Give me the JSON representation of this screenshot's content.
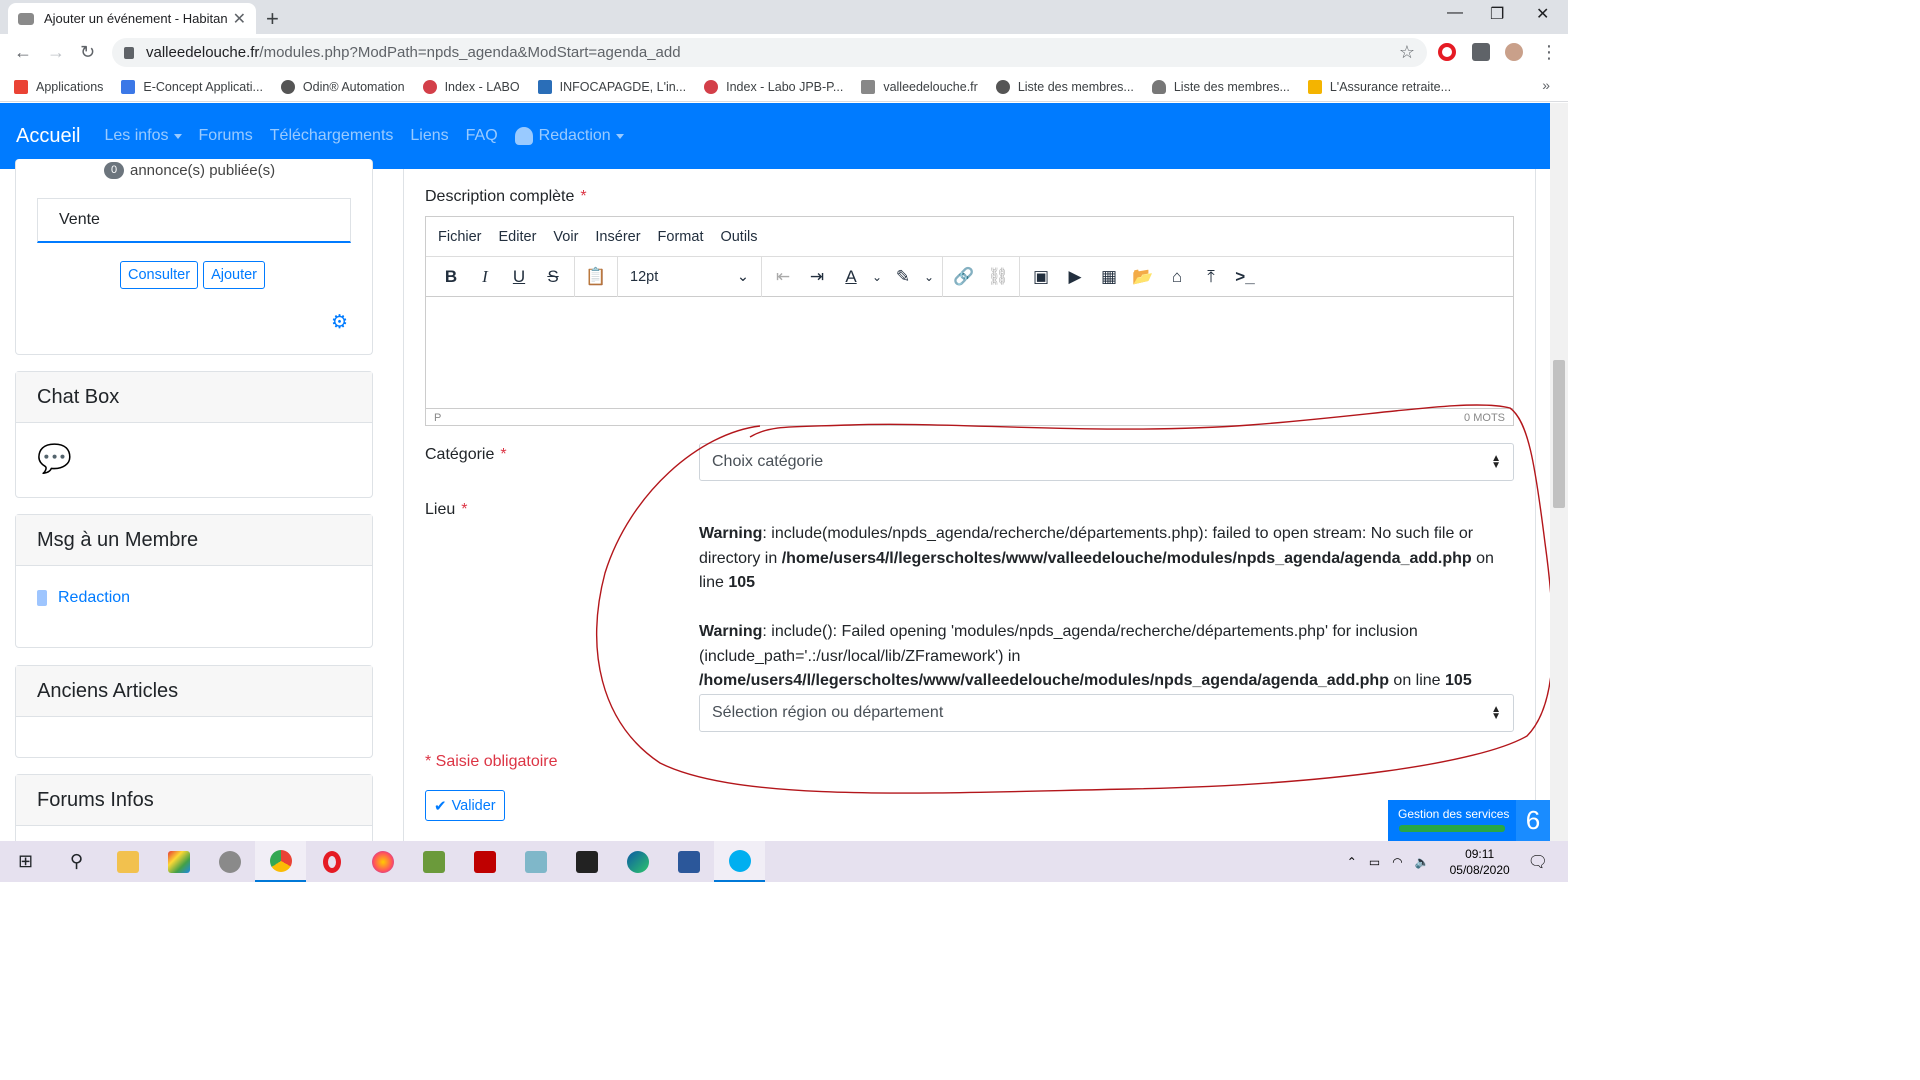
{
  "browser": {
    "tab_title": "Ajouter un événement - Habitant",
    "url_host": "valleedelouche.fr",
    "url_path": "/modules.php?ModPath=npds_agenda&ModStart=agenda_add",
    "bookmarks": [
      {
        "label": "Applications",
        "color": "#ea4335"
      },
      {
        "label": "E-Concept Applicati...",
        "color": "#3b78e7"
      },
      {
        "label": "Odin® Automation",
        "color": "#555555"
      },
      {
        "label": "Index - LABO",
        "color": "#d33f49"
      },
      {
        "label": "INFOCAPAGDE, L'in...",
        "color": "#2a6eb8"
      },
      {
        "label": "Index - Labo JPB-P...",
        "color": "#d33f49"
      },
      {
        "label": "valleedelouche.fr",
        "color": "#888888"
      },
      {
        "label": "Liste des membres...",
        "color": "#555555"
      },
      {
        "label": "Liste des membres...",
        "color": "#777777"
      },
      {
        "label": "L'Assurance retraite...",
        "color": "#f4b400"
      }
    ]
  },
  "nav": {
    "brand": "Accueil",
    "links": [
      "Les infos",
      "Forums",
      "Téléchargements",
      "Liens",
      "FAQ",
      "Redaction"
    ]
  },
  "sidebar": {
    "annonces_count": "0",
    "annonces_text": "annonce(s) publiée(s)",
    "vente_input": "Vente",
    "consulter": "Consulter",
    "ajouter": "Ajouter",
    "chat_title": "Chat Box",
    "msg_title": "Msg à un Membre",
    "msg_link": "Redaction",
    "anciens_title": "Anciens Articles",
    "forums_title": "Forums Infos"
  },
  "form": {
    "desc_label": "Description complète",
    "req_star": "*",
    "menu": [
      "Fichier",
      "Editer",
      "Voir",
      "Insérer",
      "Format",
      "Outils"
    ],
    "font_size": "12pt",
    "status_path": "P",
    "word_count": "0 MOTS",
    "categorie_label": "Catégorie",
    "categorie_select": "Choix catégorie",
    "lieu_label": "Lieu",
    "warn1_head": "Warning",
    "warn1_text": ": include(modules/npds_agenda/recherche/départements.php): failed to open stream: No such file or directory in ",
    "warn1_path": "/home/users4/l/legerscholtes/www/valleedelouche/modules/npds_agenda/agenda_add.php",
    "warn1_online": " on line ",
    "warn1_line": "105",
    "warn2_head": "Warning",
    "warn2_text": ": include(): Failed opening 'modules/npds_agenda/recherche/départements.php' for inclusion (include_path='.:/usr/local/lib/ZFramework') in ",
    "warn2_path": "/home/users4/l/legerscholtes/www/valleedelouche/modules/npds_agenda/agenda_add.php",
    "warn2_online": " on line ",
    "warn2_line": "105",
    "region_select": "Sélection région ou département",
    "saisie": "* Saisie obligatoire",
    "valider": "Valider"
  },
  "toast": {
    "label": "Gestion des services",
    "count": "6"
  },
  "taskbar": {
    "time": "09:11",
    "date": "05/08/2020"
  }
}
